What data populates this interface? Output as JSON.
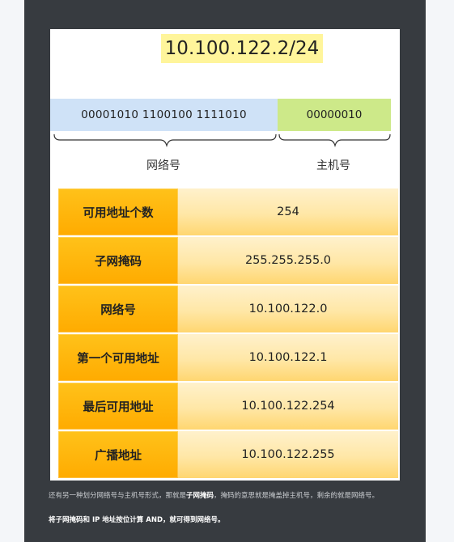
{
  "diagram": {
    "ip_cidr": "10.100.122.2/24",
    "network_bits": "00001010 1100100 1111010",
    "host_bits": "00000010",
    "network_label": "网络号",
    "host_label": "主机号"
  },
  "table": {
    "rows": [
      {
        "key": "可用地址个数",
        "value": "254"
      },
      {
        "key": "子网掩码",
        "value": "255.255.255.0"
      },
      {
        "key": "网络号",
        "value": "10.100.122.0"
      },
      {
        "key": "第一个可用地址",
        "value": "10.100.122.1"
      },
      {
        "key": "最后可用地址",
        "value": "10.100.122.254"
      },
      {
        "key": "广播地址",
        "value": "10.100.122.255"
      }
    ]
  },
  "notes": {
    "line1_a": "还有另一种划分网络号与主机号形式，那就是",
    "line1_b": "子网掩码",
    "line1_c": "，掩码的意思就是掩盖掉主机号，剩余的就是网络号。",
    "line2": "将子网掩码和 IP 地址按位计算 AND，就可得到网络号。"
  },
  "colors": {
    "panel": "#373b40",
    "ip_highlight": "#fff59b",
    "network_bits_bg": "#cfe2f7",
    "host_bits_bg": "#cde989",
    "key_cell": "#ffab00",
    "value_cell": "#ffe7a6"
  }
}
